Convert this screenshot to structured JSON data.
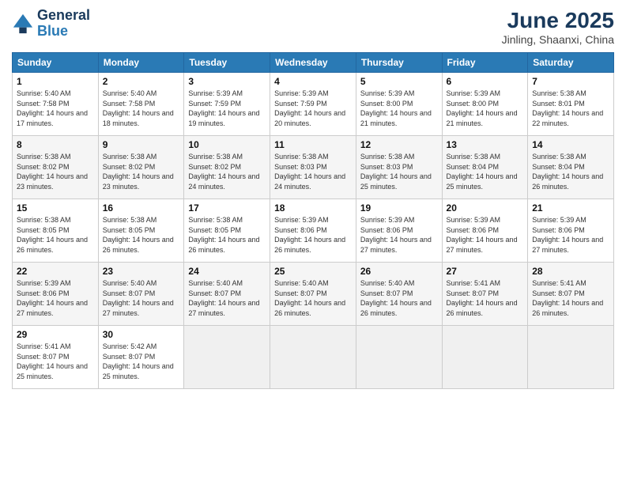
{
  "logo": {
    "general": "General",
    "blue": "Blue"
  },
  "title": {
    "month_year": "June 2025",
    "location": "Jinling, Shaanxi, China"
  },
  "days_of_week": [
    "Sunday",
    "Monday",
    "Tuesday",
    "Wednesday",
    "Thursday",
    "Friday",
    "Saturday"
  ],
  "weeks": [
    [
      {
        "num": "1",
        "sunrise": "Sunrise: 5:40 AM",
        "sunset": "Sunset: 7:58 PM",
        "daylight": "Daylight: 14 hours and 17 minutes."
      },
      {
        "num": "2",
        "sunrise": "Sunrise: 5:40 AM",
        "sunset": "Sunset: 7:58 PM",
        "daylight": "Daylight: 14 hours and 18 minutes."
      },
      {
        "num": "3",
        "sunrise": "Sunrise: 5:39 AM",
        "sunset": "Sunset: 7:59 PM",
        "daylight": "Daylight: 14 hours and 19 minutes."
      },
      {
        "num": "4",
        "sunrise": "Sunrise: 5:39 AM",
        "sunset": "Sunset: 7:59 PM",
        "daylight": "Daylight: 14 hours and 20 minutes."
      },
      {
        "num": "5",
        "sunrise": "Sunrise: 5:39 AM",
        "sunset": "Sunset: 8:00 PM",
        "daylight": "Daylight: 14 hours and 21 minutes."
      },
      {
        "num": "6",
        "sunrise": "Sunrise: 5:39 AM",
        "sunset": "Sunset: 8:00 PM",
        "daylight": "Daylight: 14 hours and 21 minutes."
      },
      {
        "num": "7",
        "sunrise": "Sunrise: 5:38 AM",
        "sunset": "Sunset: 8:01 PM",
        "daylight": "Daylight: 14 hours and 22 minutes."
      }
    ],
    [
      {
        "num": "8",
        "sunrise": "Sunrise: 5:38 AM",
        "sunset": "Sunset: 8:02 PM",
        "daylight": "Daylight: 14 hours and 23 minutes."
      },
      {
        "num": "9",
        "sunrise": "Sunrise: 5:38 AM",
        "sunset": "Sunset: 8:02 PM",
        "daylight": "Daylight: 14 hours and 23 minutes."
      },
      {
        "num": "10",
        "sunrise": "Sunrise: 5:38 AM",
        "sunset": "Sunset: 8:02 PM",
        "daylight": "Daylight: 14 hours and 24 minutes."
      },
      {
        "num": "11",
        "sunrise": "Sunrise: 5:38 AM",
        "sunset": "Sunset: 8:03 PM",
        "daylight": "Daylight: 14 hours and 24 minutes."
      },
      {
        "num": "12",
        "sunrise": "Sunrise: 5:38 AM",
        "sunset": "Sunset: 8:03 PM",
        "daylight": "Daylight: 14 hours and 25 minutes."
      },
      {
        "num": "13",
        "sunrise": "Sunrise: 5:38 AM",
        "sunset": "Sunset: 8:04 PM",
        "daylight": "Daylight: 14 hours and 25 minutes."
      },
      {
        "num": "14",
        "sunrise": "Sunrise: 5:38 AM",
        "sunset": "Sunset: 8:04 PM",
        "daylight": "Daylight: 14 hours and 26 minutes."
      }
    ],
    [
      {
        "num": "15",
        "sunrise": "Sunrise: 5:38 AM",
        "sunset": "Sunset: 8:05 PM",
        "daylight": "Daylight: 14 hours and 26 minutes."
      },
      {
        "num": "16",
        "sunrise": "Sunrise: 5:38 AM",
        "sunset": "Sunset: 8:05 PM",
        "daylight": "Daylight: 14 hours and 26 minutes."
      },
      {
        "num": "17",
        "sunrise": "Sunrise: 5:38 AM",
        "sunset": "Sunset: 8:05 PM",
        "daylight": "Daylight: 14 hours and 26 minutes."
      },
      {
        "num": "18",
        "sunrise": "Sunrise: 5:39 AM",
        "sunset": "Sunset: 8:06 PM",
        "daylight": "Daylight: 14 hours and 26 minutes."
      },
      {
        "num": "19",
        "sunrise": "Sunrise: 5:39 AM",
        "sunset": "Sunset: 8:06 PM",
        "daylight": "Daylight: 14 hours and 27 minutes."
      },
      {
        "num": "20",
        "sunrise": "Sunrise: 5:39 AM",
        "sunset": "Sunset: 8:06 PM",
        "daylight": "Daylight: 14 hours and 27 minutes."
      },
      {
        "num": "21",
        "sunrise": "Sunrise: 5:39 AM",
        "sunset": "Sunset: 8:06 PM",
        "daylight": "Daylight: 14 hours and 27 minutes."
      }
    ],
    [
      {
        "num": "22",
        "sunrise": "Sunrise: 5:39 AM",
        "sunset": "Sunset: 8:06 PM",
        "daylight": "Daylight: 14 hours and 27 minutes."
      },
      {
        "num": "23",
        "sunrise": "Sunrise: 5:40 AM",
        "sunset": "Sunset: 8:07 PM",
        "daylight": "Daylight: 14 hours and 27 minutes."
      },
      {
        "num": "24",
        "sunrise": "Sunrise: 5:40 AM",
        "sunset": "Sunset: 8:07 PM",
        "daylight": "Daylight: 14 hours and 27 minutes."
      },
      {
        "num": "25",
        "sunrise": "Sunrise: 5:40 AM",
        "sunset": "Sunset: 8:07 PM",
        "daylight": "Daylight: 14 hours and 26 minutes."
      },
      {
        "num": "26",
        "sunrise": "Sunrise: 5:40 AM",
        "sunset": "Sunset: 8:07 PM",
        "daylight": "Daylight: 14 hours and 26 minutes."
      },
      {
        "num": "27",
        "sunrise": "Sunrise: 5:41 AM",
        "sunset": "Sunset: 8:07 PM",
        "daylight": "Daylight: 14 hours and 26 minutes."
      },
      {
        "num": "28",
        "sunrise": "Sunrise: 5:41 AM",
        "sunset": "Sunset: 8:07 PM",
        "daylight": "Daylight: 14 hours and 26 minutes."
      }
    ],
    [
      {
        "num": "29",
        "sunrise": "Sunrise: 5:41 AM",
        "sunset": "Sunset: 8:07 PM",
        "daylight": "Daylight: 14 hours and 25 minutes."
      },
      {
        "num": "30",
        "sunrise": "Sunrise: 5:42 AM",
        "sunset": "Sunset: 8:07 PM",
        "daylight": "Daylight: 14 hours and 25 minutes."
      },
      null,
      null,
      null,
      null,
      null
    ]
  ]
}
